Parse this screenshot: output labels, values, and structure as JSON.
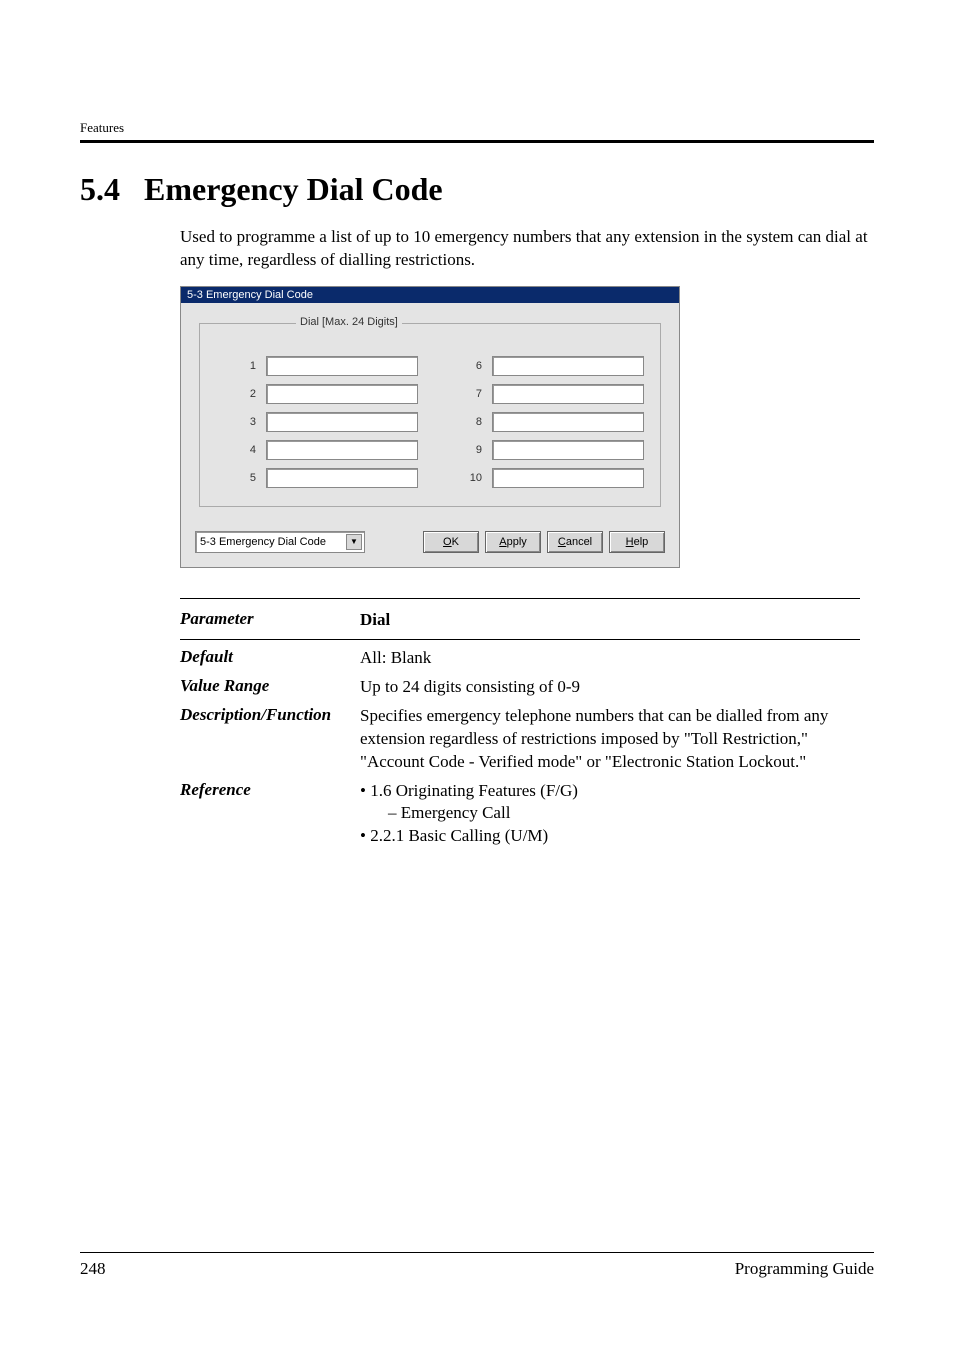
{
  "running_head": "Features",
  "section_number": "5.4",
  "section_title": "Emergency Dial Code",
  "intro": "Used to programme a list of up to 10 emergency numbers that any extension in the system can dial at any time, regardless of dialling restrictions.",
  "dialog": {
    "title": "5-3 Emergency Dial Code",
    "group_label": "Dial [Max. 24 Digits]",
    "left_nums": [
      "1",
      "2",
      "3",
      "4",
      "5"
    ],
    "right_nums": [
      "6",
      "7",
      "8",
      "9",
      "10"
    ],
    "footer_select": "5-3 Emergency Dial Code",
    "btn_ok_u": "O",
    "btn_ok_rest": "K",
    "btn_apply_u": "A",
    "btn_apply_rest": "pply",
    "btn_cancel_u": "C",
    "btn_cancel_rest": "ancel",
    "btn_help_u": "H",
    "btn_help_rest": "elp"
  },
  "params": {
    "parameter_label": "Parameter",
    "parameter_value": "Dial",
    "default_label": "Default",
    "default_value": "All: Blank",
    "range_label": "Value Range",
    "range_value": "Up to 24 digits consisting of 0-9",
    "desc_label": "Description/Function",
    "desc_value": "Specifies emergency telephone numbers that can be dialled from any extension regardless of restrictions imposed by \"Toll Restriction,\" \"Account Code - Verified mode\" or \"Electronic Station Lockout.\"",
    "ref_label": "Reference",
    "ref_line1": "• 1.6 Originating Features (F/G)",
    "ref_line2": "– Emergency Call",
    "ref_line3": "• 2.2.1 Basic Calling (U/M)"
  },
  "footer": {
    "page_num": "248",
    "doc_title": "Programming Guide"
  },
  "chart_data": null
}
